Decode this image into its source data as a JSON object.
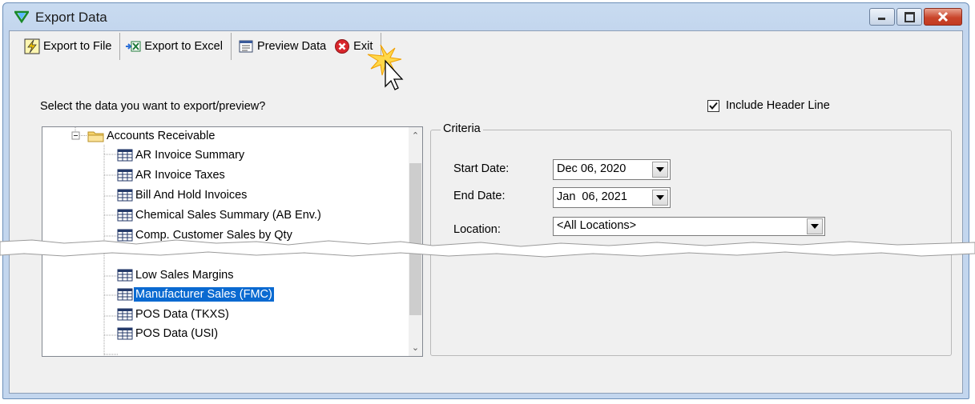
{
  "window": {
    "title": "Export Data"
  },
  "toolbar": {
    "export_file": "Export to File",
    "export_excel": "Export to Excel",
    "preview": "Preview Data",
    "exit": "Exit"
  },
  "prompt": "Select the data you want to export/preview?",
  "include_header": {
    "label": "Include Header Line",
    "checked": true
  },
  "tree": {
    "folder": "Accounts Receivable",
    "items_top": [
      "AR Invoice Summary",
      "AR Invoice Taxes",
      "Bill And Hold Invoices",
      "Chemical Sales Summary (AB Env.)",
      "Comp. Customer Sales by Qty"
    ],
    "items_bottom": [
      "Low Sales Margins",
      "Manufacturer Sales (FMC)",
      "POS Data (TKXS)",
      "POS Data (USI)"
    ],
    "selected": "Manufacturer Sales (FMC)"
  },
  "criteria": {
    "legend": "Criteria",
    "start_label": "Start Date:",
    "start_value": "Dec 06, 2020",
    "end_label": "End Date:",
    "end_value": "Jan  06, 2021",
    "location_label": "Location:",
    "location_value": "<All Locations>"
  },
  "colors": {
    "selection": "#0a6ad1",
    "titlebar": "#c9dbf0",
    "close_button": "#c9452b"
  },
  "icons": [
    "app-check-icon",
    "lightning-icon",
    "excel-icon",
    "preview-icon",
    "exit-icon",
    "folder-icon",
    "table-icon",
    "cursor-icon",
    "minimize-icon",
    "maximize-icon",
    "close-icon"
  ]
}
